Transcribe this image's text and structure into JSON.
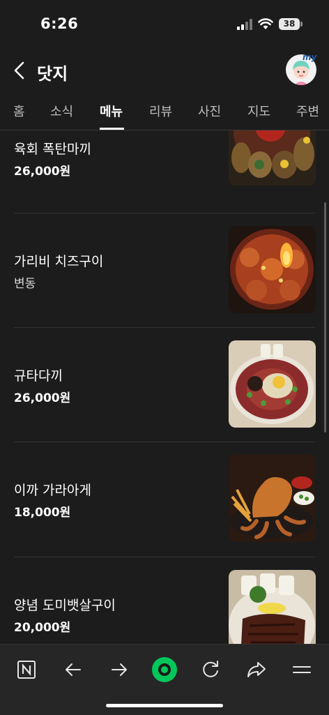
{
  "status": {
    "time": "6:26",
    "battery": "38"
  },
  "header": {
    "title": "닷지",
    "avatar_badge": "my"
  },
  "tabs": [
    {
      "label": "홈"
    },
    {
      "label": "소식"
    },
    {
      "label": "메뉴",
      "active": true
    },
    {
      "label": "리뷰"
    },
    {
      "label": "사진"
    },
    {
      "label": "지도"
    },
    {
      "label": "주변"
    }
  ],
  "menu": [
    {
      "name": "육회 폭탄마끼",
      "price": "26,000원"
    },
    {
      "name": "가리비 치즈구이",
      "price": "변동"
    },
    {
      "name": "규타다끼",
      "price": "26,000원"
    },
    {
      "name": "이까 가라아게",
      "price": "18,000원"
    },
    {
      "name": "양념 도미뱃살구이",
      "price": "20,000원"
    }
  ],
  "colors": {
    "background": "#1c1c1c",
    "bottom_bar": "#262626",
    "accent_green": "#03c75a"
  },
  "bottom_nav": {
    "items": [
      "naver-logo-icon",
      "back-arrow-icon",
      "forward-arrow-icon",
      "green-dot-icon",
      "refresh-icon",
      "share-icon",
      "menu-icon"
    ]
  }
}
